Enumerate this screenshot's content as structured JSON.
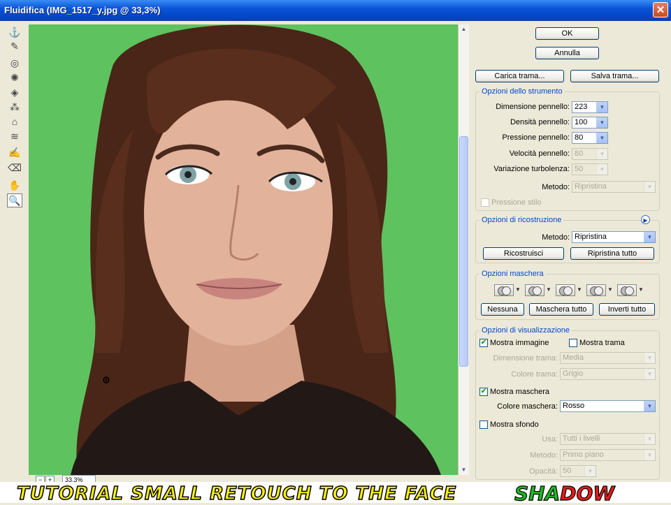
{
  "window": {
    "title": "Fluidifica (IMG_1517_y.jpg @ 33,3%)",
    "close_glyph": "✕"
  },
  "tools": [
    {
      "name": "warp-tool-icon",
      "glyph": "⚓"
    },
    {
      "name": "reconstruct-tool-icon",
      "glyph": "✎"
    },
    {
      "name": "twirl-tool-icon",
      "glyph": "◎"
    },
    {
      "name": "pucker-tool-icon",
      "glyph": "✺"
    },
    {
      "name": "bloat-tool-icon",
      "glyph": "◈"
    },
    {
      "name": "push-left-tool-icon",
      "glyph": "⁂"
    },
    {
      "name": "mirror-tool-icon",
      "glyph": "⌂"
    },
    {
      "name": "turbulence-tool-icon",
      "glyph": "≋"
    },
    {
      "name": "freeze-mask-tool-icon",
      "glyph": "✍"
    },
    {
      "name": "thaw-mask-tool-icon",
      "glyph": "⌫"
    },
    {
      "name": "hand-tool-icon",
      "glyph": "✋"
    },
    {
      "name": "zoom-tool-icon",
      "glyph": "🔍"
    }
  ],
  "status": {
    "zoom": "33,3%",
    "minus": "−",
    "plus": "+"
  },
  "buttons": {
    "ok": "OK",
    "cancel": "Annulla",
    "load_mesh": "Carica trama...",
    "save_mesh": "Salva trama...",
    "reconstruct": "Ricostruisci",
    "restore_all": "Ripristina tutto",
    "none": "Nessuna",
    "mask_all": "Maschera tutto",
    "invert_all": "Inverti tutto"
  },
  "tool_options": {
    "legend": "Opzioni dello strumento",
    "brush_size_label": "Dimensione pennello:",
    "brush_size": "223",
    "brush_density_label": "Densità pennello:",
    "brush_density": "100",
    "brush_pressure_label": "Pressione pennello:",
    "brush_pressure": "80",
    "brush_rate_label": "Velocità pennello:",
    "brush_rate": "80",
    "turbulent_jitter_label": "Variazione turbolenza:",
    "turbulent_jitter": "50",
    "mode_label": "Metodo:",
    "mode": "Ripristina",
    "stylus_pressure_label": "Pressione stilo"
  },
  "reconstruct_options": {
    "legend": "Opzioni di ricostruzione",
    "mode_label": "Metodo:",
    "mode": "Ripristina"
  },
  "mask_options": {
    "legend": "Opzioni maschera"
  },
  "view_options": {
    "legend": "Opzioni di visualizzazione",
    "show_image_label": "Mostra immagine",
    "show_image": true,
    "show_mesh_label": "Mostra trama",
    "show_mesh": false,
    "mesh_size_label": "Dimensione trama:",
    "mesh_size": "Media",
    "mesh_color_label": "Colore trama:",
    "mesh_color": "Grigio",
    "show_mask_label": "Mostra maschera",
    "show_mask": true,
    "mask_color_label": "Colore maschera:",
    "mask_color": "Rosso",
    "show_backdrop_label": "Mostra sfondo",
    "show_backdrop": false,
    "use_label": "Usa:",
    "use": "Tutti i livelli",
    "backdrop_mode_label": "Metodo:",
    "backdrop_mode": "Primo piano",
    "opacity_label": "Opacità:",
    "opacity": "50"
  },
  "banner": {
    "text": "TUTORIAL SMALL RETOUCH TO THE FACE",
    "brand_part1": "SHA",
    "brand_part2": "DOW"
  },
  "colors": {
    "titlebar": "#0a54d8",
    "canvas_bg": "#5ec25f",
    "legend_blue": "#0046d5",
    "banner_yellow": "#f7ef11"
  }
}
